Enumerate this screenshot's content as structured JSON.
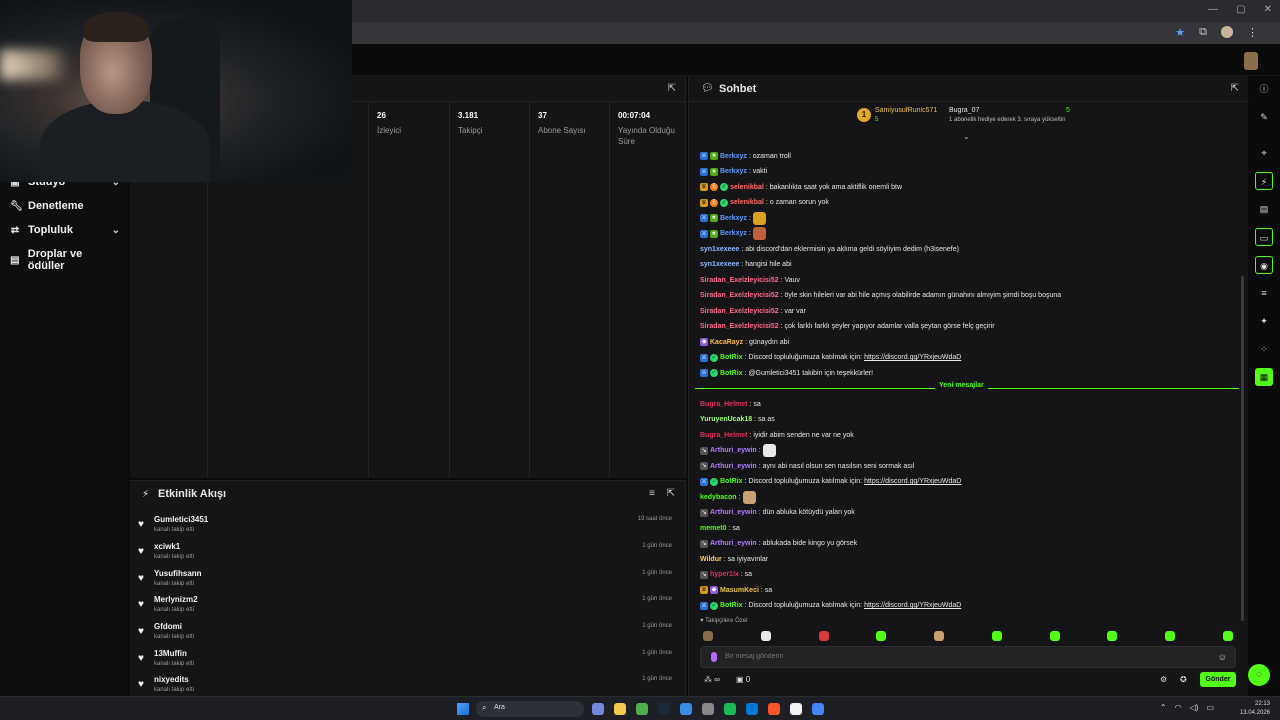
{
  "browser": {
    "window_controls": [
      "—",
      "▢",
      "✕"
    ],
    "icons": [
      "star-icon",
      "extensions-icon",
      "profile-icon",
      "menu-icon"
    ]
  },
  "sidebar": {
    "items": [
      {
        "label": "Stüdyo",
        "icon": "studio-icon",
        "expandable": true
      },
      {
        "label": "Denetleme",
        "icon": "wrench-icon",
        "expandable": false
      },
      {
        "label": "Topluluk",
        "icon": "community-icon",
        "expandable": true
      },
      {
        "label": "Droplar ve ödüller",
        "icon": "gift-icon",
        "expandable": false
      }
    ]
  },
  "stats": {
    "columns": [
      {
        "value": "26",
        "label": "İzleyici"
      },
      {
        "value": "3.181",
        "label": "Takipçi"
      },
      {
        "value": "37",
        "label": "Abone Sayısı"
      },
      {
        "value": "00:07:04",
        "label": "Yayında Olduğu Süre"
      }
    ]
  },
  "activity": {
    "title": "Etkinlik Akışı",
    "items": [
      {
        "name": "Gumletici3451",
        "sub": "kanalı takip etti",
        "time": "19 saat önce"
      },
      {
        "name": "xciwk1",
        "sub": "kanalı takip etti",
        "time": "1 gün önce"
      },
      {
        "name": "Yusufihsann",
        "sub": "kanalı takip etti",
        "time": "1 gün önce"
      },
      {
        "name": "Merlynizm2",
        "sub": "kanalı takip etti",
        "time": "1 gün önce"
      },
      {
        "name": "Gfdomi",
        "sub": "kanalı takip etti",
        "time": "1 gün önce"
      },
      {
        "name": "13Muffin",
        "sub": "kanalı takip etti",
        "time": "1 gün önce"
      },
      {
        "name": "nixyedits",
        "sub": "kanalı takip etti",
        "time": "1 gün önce"
      }
    ]
  },
  "chat": {
    "title": "Sohbet",
    "pinned": {
      "rank": "1",
      "user": "SamiyusufRunic571",
      "count": "5",
      "user2": "Bugra_07",
      "note": "1 abonelik hediye ederek 3. sıraya yükseltin",
      "count2": "5"
    },
    "messages_old": [
      {
        "user": "Berkxyz",
        "color": "#5b9cff",
        "text": ": ozaman troll",
        "badges": [
          "mod",
          "sub"
        ]
      },
      {
        "user": "Berkxyz",
        "color": "#5b9cff",
        "text": ": vakti",
        "badges": [
          "mod",
          "sub"
        ]
      },
      {
        "user": "selenikbal",
        "color": "#ff6b6b",
        "text": ": bakanlıkta saat yok ama aktiflik onemli btw",
        "badges": [
          "crown",
          "orange",
          "green"
        ]
      },
      {
        "user": "selenikbal",
        "color": "#ff6b6b",
        "text": ": o zaman sorun yok",
        "badges": [
          "crown",
          "orange",
          "green"
        ]
      },
      {
        "user": "Berkxyz",
        "color": "#5b9cff",
        "text": ":",
        "badges": [
          "mod",
          "sub"
        ],
        "emote": "#d9a020"
      },
      {
        "user": "Berkxyz",
        "color": "#5b9cff",
        "text": ":",
        "badges": [
          "mod",
          "sub"
        ],
        "emote": "#c0603a"
      },
      {
        "user": "syn1xexeee",
        "color": "#8fb8ff",
        "text": ": abi discord'dan eklermisin ya aklıma geldi söyliyim dedim (h3isenefe)",
        "badges": []
      },
      {
        "user": "syn1xexeee",
        "color": "#8fb8ff",
        "text": ": hangisi hile abi",
        "badges": []
      },
      {
        "user": "Siradan_Exelzleyicisi52",
        "color": "#ff6b8a",
        "text": ": Vauv",
        "badges": []
      },
      {
        "user": "Siradan_Exelzleyicisi52",
        "color": "#ff6b8a",
        "text": ": öyle skin hileleri var abi hile açmış olabilirde adamın günahını almıyim şimdi boşu boşuna",
        "badges": []
      },
      {
        "user": "Siradan_Exelzleyicisi52",
        "color": "#ff6b8a",
        "text": ": var var",
        "badges": []
      },
      {
        "user": "Siradan_Exelzleyicisi52",
        "color": "#ff6b8a",
        "text": ": çok farklı farklı şeyler yapıyor adamlar valla şeytan görse felç geçirir",
        "badges": []
      },
      {
        "user": "KacaRayz",
        "color": "#ffb84d",
        "text": ": günaydın abi",
        "badges": [
          "purple"
        ]
      },
      {
        "user": "BotRix",
        "color": "#53fc18",
        "text": ": Discord topluluğumuza katılmak için: ",
        "link": "https://discord.gg/YRxjeuWdaD",
        "badges": [
          "mod",
          "green"
        ]
      },
      {
        "user": "BotRix",
        "color": "#53fc18",
        "text": ": @Gumletici3451 takibin için teşekkürler!",
        "badges": [
          "mod",
          "green"
        ]
      }
    ],
    "new_messages_label": "Yeni mesajlar",
    "messages_new": [
      {
        "user": "Bugra_Helmet",
        "color": "#e0305a",
        "text": ": sa",
        "badges": []
      },
      {
        "user": "YuruyenUcak18",
        "color": "#9cff6b",
        "text": ": sa as",
        "badges": []
      },
      {
        "user": "Bugra_Helmet",
        "color": "#e0305a",
        "text": ": iyidir abim senden ne var ne yok",
        "badges": []
      },
      {
        "user": "Arthuri_eywin",
        "color": "#b57bff",
        "text": ":",
        "badges": [
          "gray"
        ],
        "emote": "#e8e8e8"
      },
      {
        "user": "Arthuri_eywin",
        "color": "#b57bff",
        "text": ": aynı abi nasıl olsun sen nasılsın seni sormak asıl",
        "badges": [
          "gray"
        ]
      },
      {
        "user": "BotRix",
        "color": "#53fc18",
        "text": ": Discord topluluğumuza katılmak için: ",
        "link": "https://discord.gg/YRxjeuWdaD",
        "badges": [
          "mod",
          "green"
        ]
      },
      {
        "user": "kedybacon",
        "color": "#53fc18",
        "text": ":",
        "badges": [],
        "emote": "#c9a070"
      },
      {
        "user": "Arthuri_eywin",
        "color": "#b57bff",
        "text": ": dün abluka kötüydü yalan yok",
        "badges": [
          "gray"
        ]
      },
      {
        "user": "memet0",
        "color": "#53fc18",
        "text": ": sa",
        "badges": []
      },
      {
        "user": "Arthuri_eywin",
        "color": "#b57bff",
        "text": ": ablukada bide kingo yu görsek",
        "badges": [
          "gray"
        ]
      },
      {
        "user": "Wildur",
        "color": "#ffd24d",
        "text": ": sa iyiyavınlar",
        "badges": []
      },
      {
        "user": "hyper1lx",
        "color": "#e0305a",
        "text": ": sa",
        "badges": [
          "gray"
        ]
      },
      {
        "user": "MasumKeci",
        "color": "#f0c24a",
        "text": ": sa",
        "badges": [
          "crown",
          "purple"
        ]
      },
      {
        "user": "BotRix",
        "color": "#53fc18",
        "text": ": Discord topluluğumuza katılmak için: ",
        "link": "https://discord.gg/YRxjeuWdaD",
        "badges": [
          "mod",
          "green"
        ]
      }
    ],
    "followers_only": "Takipçilere Özel",
    "quick_emotes": [
      "#8a6e4a",
      "#e8e8e8",
      "#d63a3a",
      "#53fc18",
      "#c9a070",
      "#53fc18",
      "#53fc18",
      "#53fc18",
      "#53fc18",
      "#53fc18"
    ],
    "input_placeholder": "Bir mesaj gönderin",
    "footer_count_a": "∞",
    "footer_count_b": "0",
    "send_label": "Gönder"
  },
  "taskbar": {
    "search_label": "Ara",
    "apps": [
      "#7289da",
      "#f2c94c",
      "#4caf50",
      "#1b2838",
      "#3a8ee6",
      "#888888",
      "#1db954",
      "#0078d4",
      "#fb542b",
      "#f2f2f2",
      "#4285f4"
    ],
    "time": "22:13",
    "date": "13.04.2026"
  }
}
